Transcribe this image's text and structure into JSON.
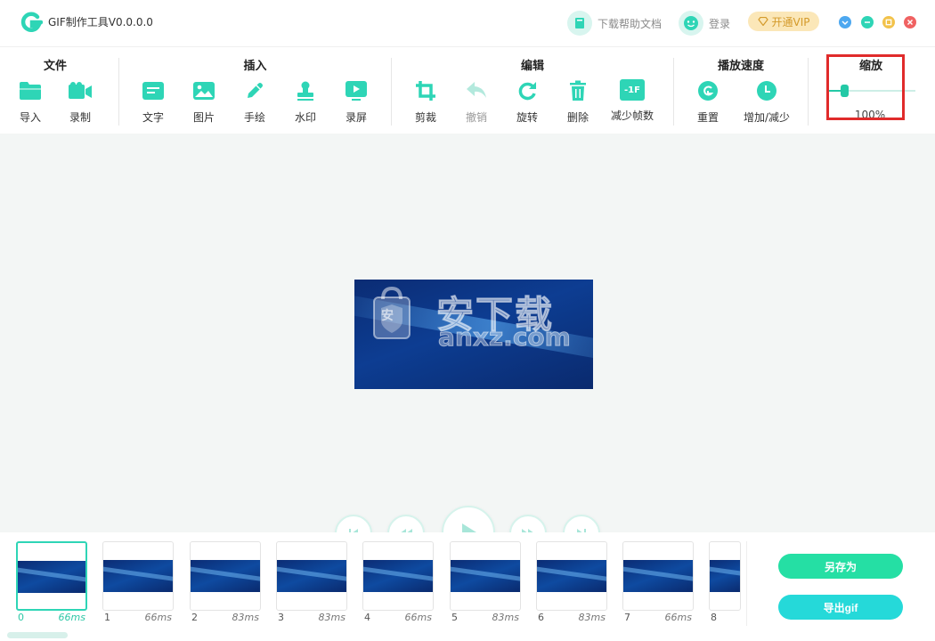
{
  "app": {
    "title": "GIF制作工具V0.0.0.0"
  },
  "header": {
    "help_label": "下载帮助文档",
    "login_label": "登录",
    "vip_label": "开通VIP"
  },
  "toolbar": {
    "groups": [
      {
        "title": "文件",
        "tools": [
          {
            "label": "导入"
          },
          {
            "label": "录制"
          }
        ]
      },
      {
        "title": "插入",
        "tools": [
          {
            "label": "文字"
          },
          {
            "label": "图片"
          },
          {
            "label": "手绘"
          },
          {
            "label": "水印"
          },
          {
            "label": "录屏"
          }
        ]
      },
      {
        "title": "编辑",
        "tools": [
          {
            "label": "剪裁"
          },
          {
            "label": "撤销"
          },
          {
            "label": "旋转"
          },
          {
            "label": "删除"
          },
          {
            "label": "减少帧数",
            "icon_text": "-1F"
          }
        ]
      },
      {
        "title": "播放速度",
        "tools": [
          {
            "label": "重置"
          },
          {
            "label": "增加/减少"
          }
        ]
      },
      {
        "title": "缩放",
        "tools": []
      }
    ],
    "zoom": {
      "value_label": "100%",
      "level": 0.1
    }
  },
  "preview": {
    "watermark_cn": "安下载",
    "watermark_url": "anxz.com",
    "watermark_badge": "安"
  },
  "timeline": {
    "frames": [
      {
        "index": "0",
        "duration": "66ms"
      },
      {
        "index": "1",
        "duration": "66ms"
      },
      {
        "index": "2",
        "duration": "83ms"
      },
      {
        "index": "3",
        "duration": "83ms"
      },
      {
        "index": "4",
        "duration": "66ms"
      },
      {
        "index": "5",
        "duration": "83ms"
      },
      {
        "index": "6",
        "duration": "83ms"
      },
      {
        "index": "7",
        "duration": "66ms"
      },
      {
        "index": "8",
        "duration": ""
      }
    ],
    "selected_index": 0
  },
  "actions": {
    "save_as_label": "另存为",
    "export_label": "导出gif"
  },
  "colors": {
    "accent": "#2ed5b6",
    "save_btn": "#25dfa4",
    "export_btn": "#25d9d9",
    "highlight": "#e02b2b"
  }
}
